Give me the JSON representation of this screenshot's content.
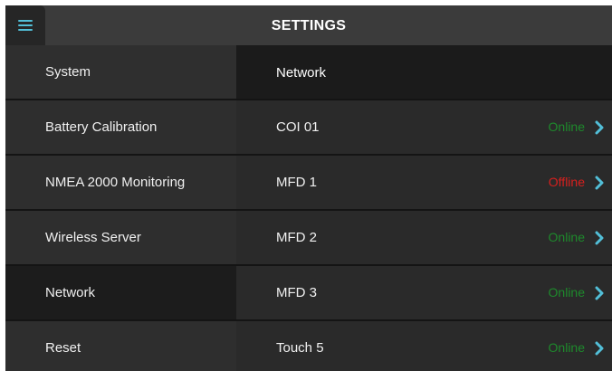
{
  "header": {
    "title": "SETTINGS",
    "menu_icon": "hamburger-menu-icon"
  },
  "sidebar": {
    "items": [
      {
        "label": "System"
      },
      {
        "label": "Battery Calibration"
      },
      {
        "label": "NMEA 2000 Monitoring"
      },
      {
        "label": "Wireless Server"
      },
      {
        "label": "Network"
      },
      {
        "label": "Reset"
      }
    ],
    "active": "Network"
  },
  "panel": {
    "title": "Network",
    "devices": [
      {
        "name": "COI 01",
        "status": "Online"
      },
      {
        "name": "MFD 1",
        "status": "Offline"
      },
      {
        "name": "MFD 2",
        "status": "Online"
      },
      {
        "name": "MFD 3",
        "status": "Online"
      },
      {
        "name": "Touch 5",
        "status": "Online"
      }
    ]
  },
  "colors": {
    "accent": "#52bfd8",
    "online": "#1e8a2c",
    "offline": "#d8201e"
  }
}
